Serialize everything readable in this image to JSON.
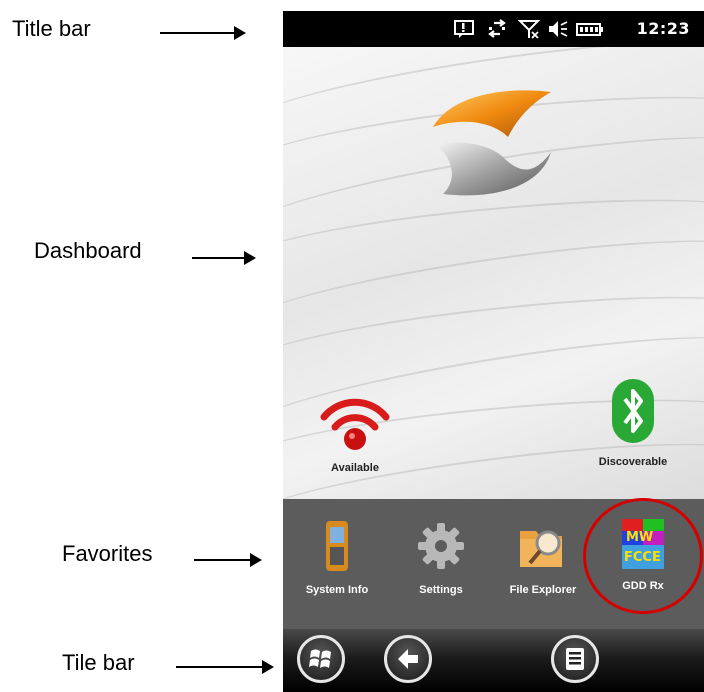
{
  "callouts": {
    "title_bar": "Title bar",
    "dashboard": "Dashboard",
    "favorites": "Favorites",
    "tile_bar": "Tile bar"
  },
  "status": {
    "time": "12:23",
    "icons": [
      "notification-icon",
      "sync-icon",
      "no-signal-icon",
      "speaker-icon",
      "battery-icon"
    ]
  },
  "dashboard": {
    "logo": "app-logo",
    "items": [
      {
        "label": "Available",
        "icon": "wifi-icon"
      },
      {
        "label": "Discoverable",
        "icon": "bluetooth-icon"
      }
    ]
  },
  "favorites": {
    "items": [
      {
        "label": "System Info",
        "icon": "device-icon"
      },
      {
        "label": "Settings",
        "icon": "gear-icon"
      },
      {
        "label": "File Explorer",
        "icon": "folder-search-icon"
      },
      {
        "label": "GDD Rx",
        "icon": "gdd-rx-icon"
      }
    ]
  },
  "tilebar": {
    "buttons": [
      "windows-start-icon",
      "back-arrow-icon",
      "menu-icon"
    ]
  },
  "colors": {
    "favorites_bg": "#5c5c5c",
    "titlebar_bg": "#000000",
    "highlight": "#d40000",
    "bluetooth": "#2aa836",
    "wifi": "#d81c1c"
  }
}
